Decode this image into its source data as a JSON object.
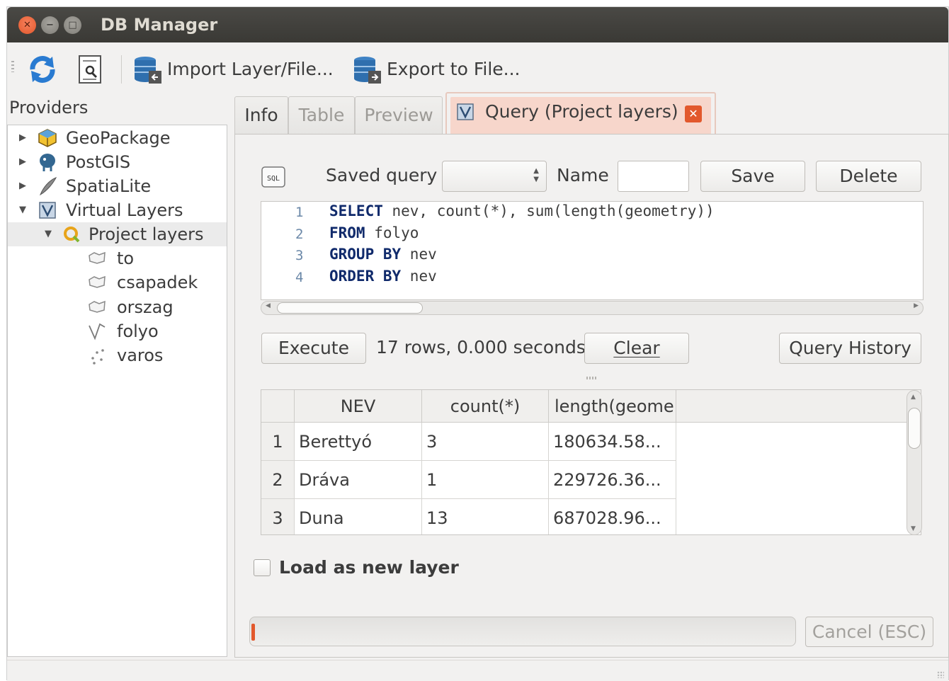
{
  "window": {
    "title": "DB Manager"
  },
  "toolbar": {
    "refresh_icon": "refresh-icon",
    "sql_window_icon": "sql-window-icon",
    "import_label": "Import Layer/File...",
    "export_label": "Export to File..."
  },
  "providers": {
    "label": "Providers",
    "items": [
      {
        "label": "GeoPackage",
        "icon": "geopackage-icon",
        "expanded": false
      },
      {
        "label": "PostGIS",
        "icon": "postgis-icon",
        "expanded": false
      },
      {
        "label": "SpatiaLite",
        "icon": "spatialite-icon",
        "expanded": false
      },
      {
        "label": "Virtual Layers",
        "icon": "virtual-layers-icon",
        "expanded": true
      }
    ],
    "project_layers": {
      "label": "Project layers",
      "selected": true
    },
    "layers": [
      {
        "label": "to",
        "icon": "polygon-layer-icon"
      },
      {
        "label": "csapadek",
        "icon": "polygon-layer-icon"
      },
      {
        "label": "orszag",
        "icon": "polygon-layer-icon"
      },
      {
        "label": "folyo",
        "icon": "line-layer-icon"
      },
      {
        "label": "varos",
        "icon": "point-layer-icon"
      }
    ]
  },
  "tabs": [
    {
      "label": "Info",
      "enabled": true
    },
    {
      "label": "Table",
      "enabled": false
    },
    {
      "label": "Preview",
      "enabled": false
    },
    {
      "label": "Query (Project layers)",
      "enabled": true,
      "active": true
    }
  ],
  "query": {
    "saved_query_label": "Saved query",
    "saved_query_value": "",
    "name_label": "Name",
    "name_value": "",
    "save_label": "Save",
    "delete_label": "Delete",
    "lines": [
      {
        "n": "1",
        "kw": "SELECT",
        "rest": " nev, count(*), sum(length(geometry))"
      },
      {
        "n": "2",
        "kw": "FROM",
        "rest": " folyo"
      },
      {
        "n": "3",
        "kw": "GROUP BY",
        "rest": " nev"
      },
      {
        "n": "4",
        "kw": "ORDER BY",
        "rest": " nev"
      }
    ],
    "execute_label": "Execute",
    "status_text": "17 rows, 0.000 seconds",
    "clear_label": "Clear",
    "history_label": "Query History"
  },
  "results": {
    "columns": [
      "NEV",
      "count(*)",
      "length(geome"
    ],
    "rows": [
      {
        "n": "1",
        "cells": [
          "Berettyó",
          "3",
          "180634.58..."
        ]
      },
      {
        "n": "2",
        "cells": [
          "Dráva",
          "1",
          "229726.36..."
        ]
      },
      {
        "n": "3",
        "cells": [
          "Duna",
          "13",
          "687028.96..."
        ]
      }
    ]
  },
  "load_layer": {
    "label": "Load as new layer",
    "checked": false
  },
  "cancel_label": "Cancel (ESC)",
  "colors": {
    "accent": "#e2582c",
    "keyword": "#102a6b",
    "line_number": "#6b88a8"
  }
}
